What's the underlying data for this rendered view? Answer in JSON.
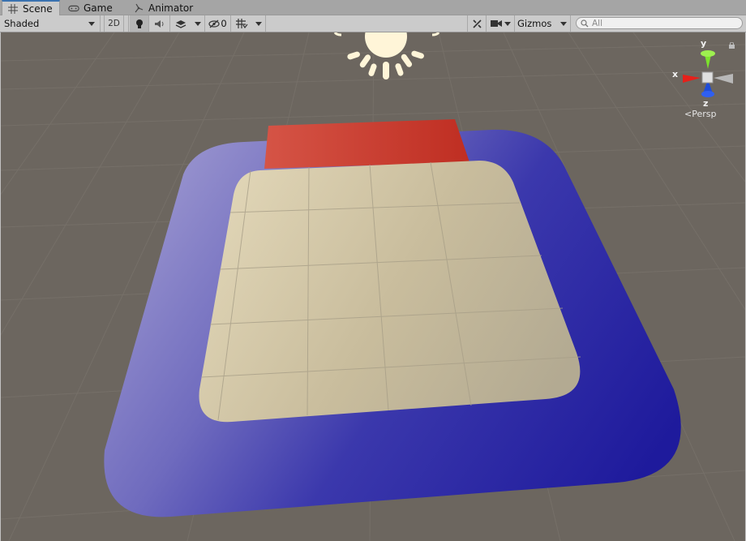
{
  "tabs": [
    {
      "label": "Scene",
      "icon": "grid-icon",
      "active": true
    },
    {
      "label": "Game",
      "icon": "gamepad-icon",
      "active": false
    },
    {
      "label": "Animator",
      "icon": "animator-icon",
      "active": false
    }
  ],
  "toolbar": {
    "draw_mode": "Shaded",
    "mode_2d": "2D",
    "hidden_count": "0",
    "gizmos_label": "Gizmos",
    "search_placeholder": "All"
  },
  "gizmo": {
    "axis_y": "y",
    "axis_x": "x",
    "axis_z": "z",
    "projection": "Persp"
  },
  "colors": {
    "ground": "#6c665f",
    "blue_plane": "#1f1ba0",
    "cream_plane": "#c9bc9c",
    "red_block": "#c93a2e",
    "sun": "#fff5d8"
  }
}
